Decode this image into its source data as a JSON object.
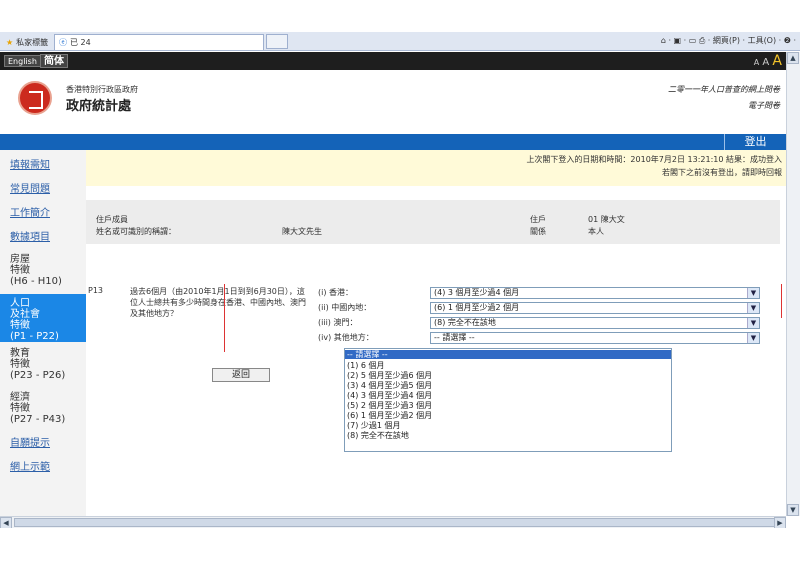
{
  "browser": {
    "tab1_label": "私家標籤",
    "tab2_label": "已 24",
    "tools_text": "⌂ · ▣ · ▭ ⎙ · 網頁(P) · 工具(O) · ❷ ·"
  },
  "lang": {
    "english": "English",
    "simplified": "简体",
    "font_sizes": [
      "A",
      "A",
      "A"
    ]
  },
  "header": {
    "dept_sub": "香港特別行政區政府",
    "dept_name": "政府統計處",
    "survey_title": "二零一一年人口普查的網上問卷",
    "survey_sub": "電子問卷"
  },
  "login_label": "登出",
  "sidebar": {
    "items": [
      {
        "label": "填報需知"
      },
      {
        "label": "常見問題"
      },
      {
        "label": "工作簡介"
      },
      {
        "label": "數據項目"
      },
      {
        "label": "房屋"
      },
      {
        "label": "特徵"
      },
      {
        "label": "(H6 - H10)"
      },
      {
        "label": "人口"
      },
      {
        "label": "及社會"
      },
      {
        "label": "特徵"
      },
      {
        "label": "(P1 - P22)"
      },
      {
        "label": "教育"
      },
      {
        "label": "特徵"
      },
      {
        "label": "(P23 - P26)"
      },
      {
        "label": "經濟"
      },
      {
        "label": "特徵"
      },
      {
        "label": "(P27 - P43)"
      },
      {
        "label": "自願提示"
      },
      {
        "label": "網上示範"
      }
    ]
  },
  "notice": {
    "line1": "上次閣下登入的日期和時間：2010年7月2日 13:21:10 結果：成功登入",
    "line2": "若閣下之前沒有登出，請即時回報"
  },
  "info": {
    "person_label": "住戶成員",
    "person_value": "",
    "name_label": "姓名或可識別的稱謂：",
    "name_value": "陳大文先生",
    "household_label": "住戶",
    "household_value": "01 陳大文",
    "relation_label": "關係",
    "relation_value": "本人"
  },
  "question": {
    "code": "P13",
    "text": "過去6個月（由2010年1月1日到到6月30日），這位人士總共有多少時間身在香港、中國內地、澳門及其他地方？",
    "rows": [
      {
        "label": "(i) 香港：",
        "value": "(4) 3 個月至少過4 個月"
      },
      {
        "label": "(ii) 中國內地：",
        "value": "(6) 1 個月至少過2 個月"
      },
      {
        "label": "(iii) 澳門：",
        "value": "(8) 完全不在該地"
      },
      {
        "label": "(iv) 其他地方：",
        "value": "-- 請選擇 --"
      }
    ],
    "dropdown_options": [
      "-- 請選擇 --",
      "(1) 6 個月",
      "(2) 5 個月至少過6 個月",
      "(3) 4 個月至少過5 個月",
      "(4) 3 個月至少過4 個月",
      "(5) 2 個月至少過3 個月",
      "(6) 1 個月至少過2 個月",
      "(7) 少過1 個月",
      "(8) 完全不在該地"
    ]
  },
  "back_label": "返回"
}
